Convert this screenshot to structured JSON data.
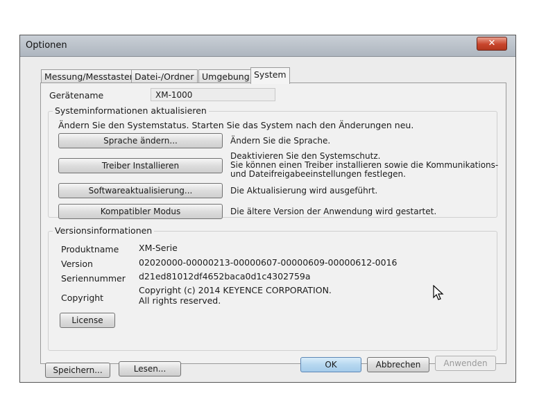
{
  "window": {
    "title": "Optionen",
    "close_icon": "close-icon",
    "close_glyph": "✕"
  },
  "tabs": [
    {
      "label": "Messung/Messtaster",
      "active": false
    },
    {
      "label": "Datei-/Ordner",
      "active": false
    },
    {
      "label": "Umgebung",
      "active": false
    },
    {
      "label": "System",
      "active": true
    }
  ],
  "device": {
    "label": "Gerätename",
    "value": "XM-1000"
  },
  "system_update": {
    "title": "Systeminformationen aktualisieren",
    "intro": "Ändern Sie den Systemstatus. Starten Sie das System nach den Änderungen neu.",
    "actions": [
      {
        "button": "Sprache ändern...",
        "description": [
          "Ändern Sie die Sprache."
        ]
      },
      {
        "button": "Treiber Installieren",
        "description": [
          "Deaktivieren Sie den Systemschutz.",
          "Sie können einen Treiber installieren sowie die Kommunikations-",
          "und Dateifreigabeeinstellungen festlegen."
        ]
      },
      {
        "button": "Softwareaktualisierung...",
        "description": [
          "Die Aktualisierung wird ausgeführt."
        ]
      },
      {
        "button": "Kompatibler Modus",
        "description": [
          "Die ältere Version der Anwendung wird gestartet."
        ]
      }
    ]
  },
  "version_info": {
    "title": "Versionsinformationen",
    "rows": [
      {
        "label": "Produktname",
        "value": [
          "XM-Serie"
        ]
      },
      {
        "label": "Version",
        "value": [
          "02020000-00000213-00000607-00000609-00000612-0016"
        ]
      },
      {
        "label": "Seriennummer",
        "value": [
          "d21ed81012df4652baca0d1c4302759a"
        ]
      },
      {
        "label": "Copyright",
        "value": [
          "Copyright (c) 2014 KEYENCE CORPORATION.",
          "All rights reserved."
        ]
      }
    ],
    "license_button": "License"
  },
  "footer": {
    "save": "Speichern...",
    "read": "Lesen...",
    "ok": "OK",
    "cancel": "Abbrechen",
    "apply": "Anwenden"
  },
  "colors": {
    "accent": "#a5cbea",
    "close": "#c8452c"
  }
}
